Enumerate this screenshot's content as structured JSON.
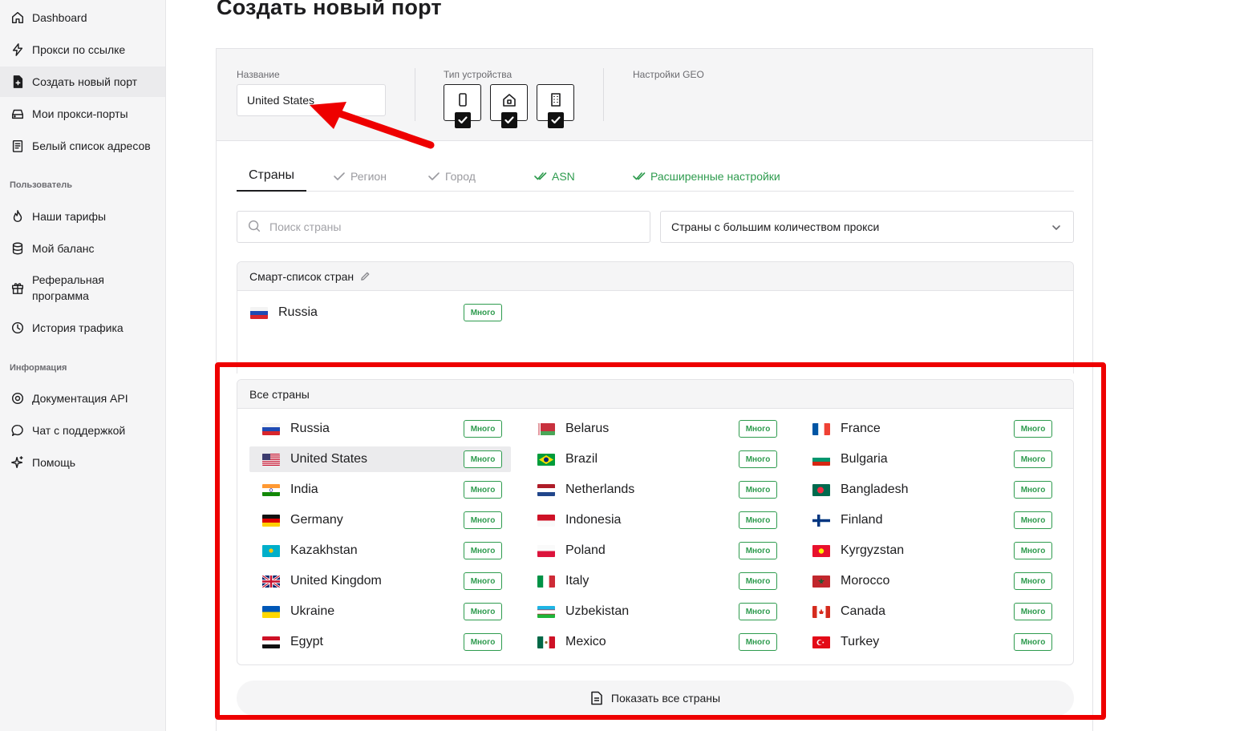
{
  "sidebar": {
    "items": [
      {
        "label": "Dashboard",
        "icon": "home-icon"
      },
      {
        "label": "Прокси по ссылке",
        "icon": "lightning-icon"
      },
      {
        "label": "Создать новый порт",
        "icon": "file-plus-icon",
        "active": true
      },
      {
        "label": "Мои прокси-порты",
        "icon": "server-icon"
      },
      {
        "label": "Белый список адресов",
        "icon": "clipboard-icon"
      }
    ],
    "section_user": "Пользователь",
    "user_items": [
      {
        "label": "Наши тарифы",
        "icon": "flame-icon"
      },
      {
        "label": "Мой баланс",
        "icon": "coins-icon"
      },
      {
        "label": "Реферальная программа",
        "icon": "gift-icon"
      },
      {
        "label": "История трафика",
        "icon": "clock-icon"
      }
    ],
    "section_info": "Информация",
    "info_items": [
      {
        "label": "Документация API",
        "icon": "gear-icon"
      },
      {
        "label": "Чат с поддержкой",
        "icon": "chat-icon"
      },
      {
        "label": "Помощь",
        "icon": "sparkle-icon"
      }
    ]
  },
  "page": {
    "title": "Создать новый порт"
  },
  "form": {
    "name_label": "Название",
    "name_value": "United States",
    "device_label": "Тип устройства",
    "devices": [
      {
        "name": "mobile",
        "icon": "phone-icon",
        "checked": true
      },
      {
        "name": "residential",
        "icon": "house-icon",
        "checked": true
      },
      {
        "name": "datacenter",
        "icon": "building-icon",
        "checked": true
      }
    ],
    "geo_label": "Настройки GEO"
  },
  "tabs": [
    {
      "label": "Страны",
      "active": true
    },
    {
      "label": "Регион"
    },
    {
      "label": "Город"
    },
    {
      "label": "ASN"
    },
    {
      "label": "Расширенные настройки"
    }
  ],
  "search": {
    "placeholder": "Поиск страны"
  },
  "filter": {
    "selected": "Страны с большим количеством прокси"
  },
  "smart_list": {
    "title": "Смарт-список стран",
    "items": [
      {
        "country": "Russia",
        "badge": "Много",
        "flag": "ru"
      }
    ]
  },
  "all_countries": {
    "title": "Все страны",
    "columns": [
      [
        {
          "country": "Russia",
          "badge": "Много",
          "flag": "ru"
        },
        {
          "country": "United States",
          "badge": "Много",
          "flag": "us",
          "selected": true
        },
        {
          "country": "India",
          "badge": "Много",
          "flag": "in"
        },
        {
          "country": "Germany",
          "badge": "Много",
          "flag": "de"
        },
        {
          "country": "Kazakhstan",
          "badge": "Много",
          "flag": "kz"
        },
        {
          "country": "United Kingdom",
          "badge": "Много",
          "flag": "gb"
        },
        {
          "country": "Ukraine",
          "badge": "Много",
          "flag": "ua"
        },
        {
          "country": "Egypt",
          "badge": "Много",
          "flag": "eg"
        }
      ],
      [
        {
          "country": "Belarus",
          "badge": "Много",
          "flag": "by"
        },
        {
          "country": "Brazil",
          "badge": "Много",
          "flag": "br"
        },
        {
          "country": "Netherlands",
          "badge": "Много",
          "flag": "nl"
        },
        {
          "country": "Indonesia",
          "badge": "Много",
          "flag": "id"
        },
        {
          "country": "Poland",
          "badge": "Много",
          "flag": "pl"
        },
        {
          "country": "Italy",
          "badge": "Много",
          "flag": "it"
        },
        {
          "country": "Uzbekistan",
          "badge": "Много",
          "flag": "uz"
        },
        {
          "country": "Mexico",
          "badge": "Много",
          "flag": "mx"
        }
      ],
      [
        {
          "country": "France",
          "badge": "Много",
          "flag": "fr"
        },
        {
          "country": "Bulgaria",
          "badge": "Много",
          "flag": "bg"
        },
        {
          "country": "Bangladesh",
          "badge": "Много",
          "flag": "bd"
        },
        {
          "country": "Finland",
          "badge": "Много",
          "flag": "fi"
        },
        {
          "country": "Kyrgyzstan",
          "badge": "Много",
          "flag": "kg"
        },
        {
          "country": "Morocco",
          "badge": "Много",
          "flag": "ma"
        },
        {
          "country": "Canada",
          "badge": "Много",
          "flag": "ca"
        },
        {
          "country": "Turkey",
          "badge": "Много",
          "flag": "tr"
        }
      ]
    ],
    "show_all_label": "Показать все страны"
  },
  "colors": {
    "accent_green": "#2e9b4e",
    "annotation_red": "#ee0000"
  }
}
